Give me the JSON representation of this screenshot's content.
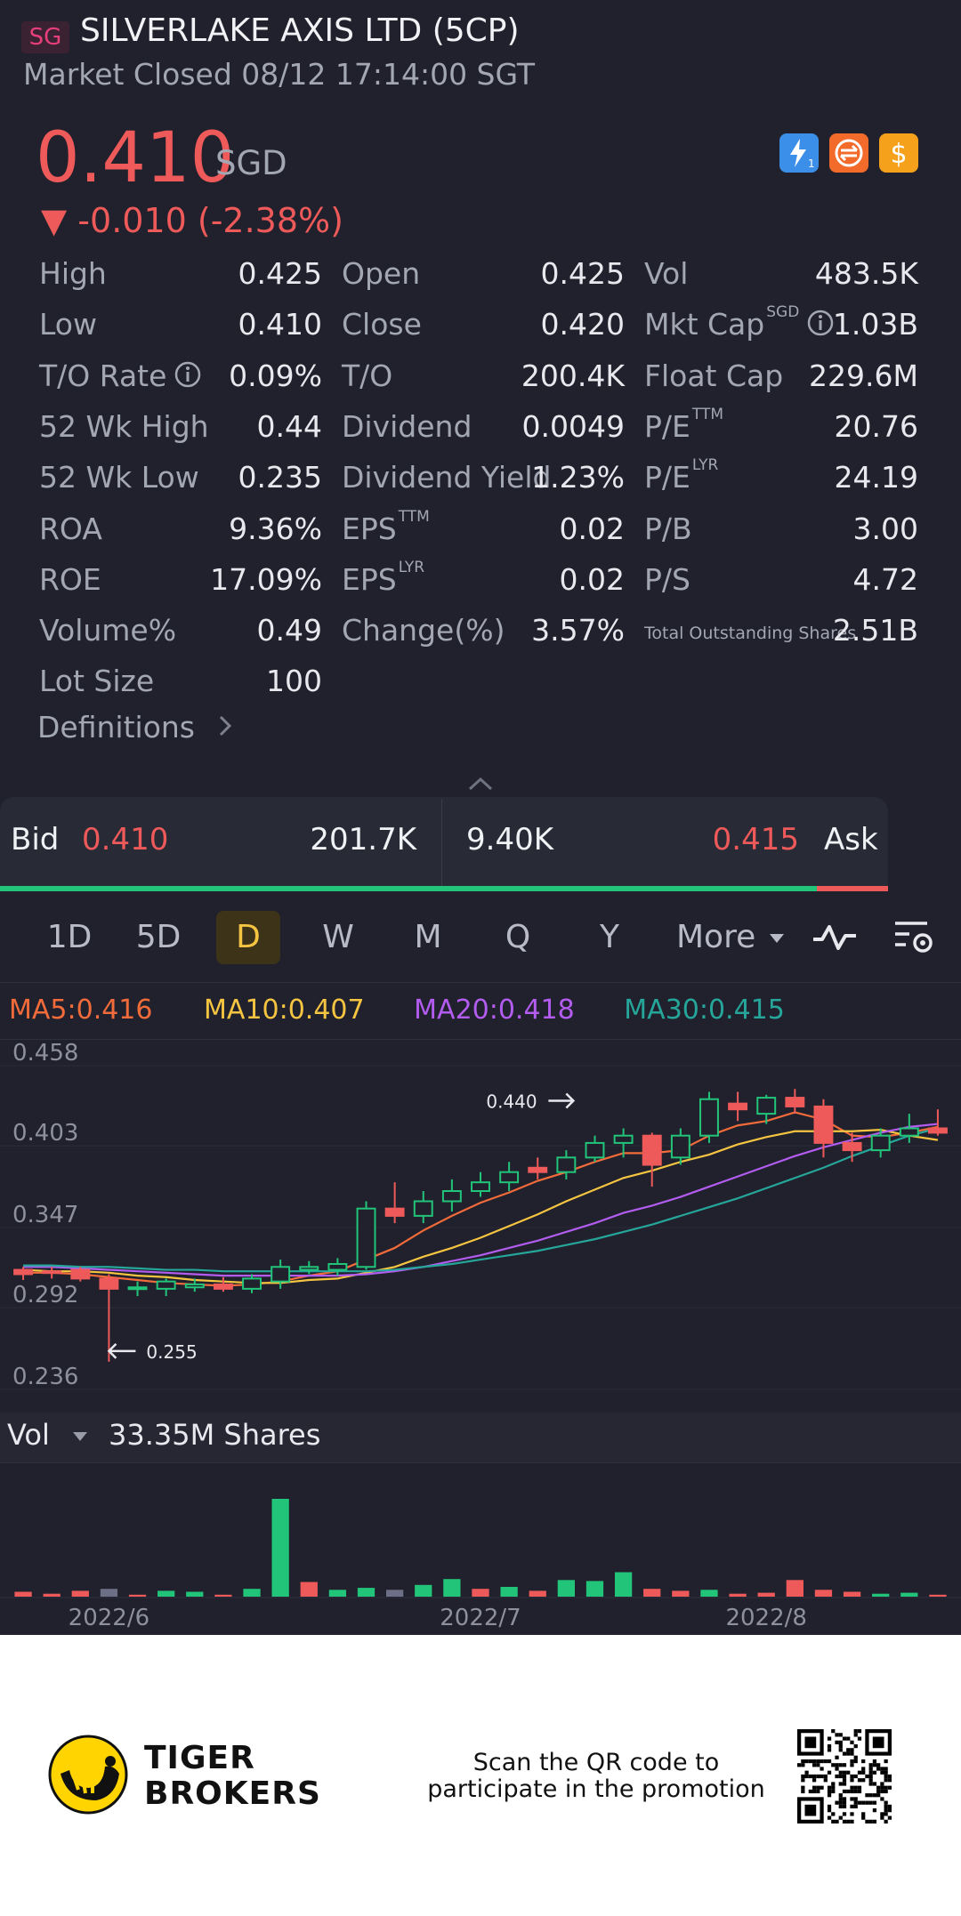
{
  "header": {
    "market_badge": "SG",
    "title": "SILVERLAKE AXIS LTD (5CP)",
    "status": "Market Closed 08/12 17:14:00 SGT"
  },
  "quote": {
    "price": "0.410",
    "currency": "SGD",
    "change": "▼ -0.010 (-2.38%)",
    "badges": [
      {
        "icon": "lightning-level1-icon",
        "color": "#3b8fe8"
      },
      {
        "icon": "swap-arrows-icon",
        "color": "#f26b2a"
      },
      {
        "icon": "dollar-icon",
        "color": "#f5a11c"
      }
    ]
  },
  "stats": {
    "rows": [
      [
        {
          "label": "High",
          "value": "0.425"
        },
        {
          "label": "Open",
          "value": "0.425"
        },
        {
          "label": "Vol",
          "value": "483.5K"
        }
      ],
      [
        {
          "label": "Low",
          "value": "0.410"
        },
        {
          "label": "Close",
          "value": "0.420"
        },
        {
          "label": "Mkt Cap",
          "sup": "SGD",
          "info": true,
          "value": "1.03B"
        }
      ],
      [
        {
          "label": "T/O Rate",
          "info": true,
          "value": "0.09%"
        },
        {
          "label": "T/O",
          "value": "200.4K"
        },
        {
          "label": "Float Cap",
          "value": "229.6M"
        }
      ],
      [
        {
          "label": "52 Wk High",
          "value": "0.44"
        },
        {
          "label": "Dividend",
          "value": "0.0049"
        },
        {
          "label": "P/E",
          "sup": "TTM",
          "value": "20.76"
        }
      ],
      [
        {
          "label": "52 Wk Low",
          "value": "0.235"
        },
        {
          "label": "Dividend Yield",
          "value": "1.23%"
        },
        {
          "label": "P/E",
          "sup": "LYR",
          "value": "24.19"
        }
      ],
      [
        {
          "label": "ROA",
          "value": "9.36%"
        },
        {
          "label": "EPS",
          "sup": "TTM",
          "value": "0.02"
        },
        {
          "label": "P/B",
          "value": "3.00"
        }
      ],
      [
        {
          "label": "ROE",
          "value": "17.09%"
        },
        {
          "label": "EPS",
          "sup": "LYR",
          "value": "0.02"
        },
        {
          "label": "P/S",
          "value": "4.72"
        }
      ],
      [
        {
          "label": "Volume%",
          "value": "0.49"
        },
        {
          "label": "Change(%)",
          "value": "3.57%"
        },
        {
          "label": "Total Outstanding Shares",
          "small": true,
          "value": "2.51B"
        }
      ],
      [
        {
          "label": "Lot Size",
          "value": "100"
        }
      ]
    ],
    "definitions": "Definitions"
  },
  "orderbook": {
    "bid_label": "Bid",
    "bid_price": "0.410",
    "bid_size": "201.7K",
    "ask_size": "9.40K",
    "ask_price": "0.415",
    "ask_label": "Ask",
    "bid_share": 0.92
  },
  "period_tabs": {
    "items": [
      "1D",
      "5D",
      "D",
      "W",
      "M",
      "Q",
      "Y"
    ],
    "active": "D",
    "more": "More"
  },
  "ma_legend": [
    {
      "label": "MA5:0.416",
      "color": "#f26b3a"
    },
    {
      "label": "MA10:0.407",
      "color": "#f5c542"
    },
    {
      "label": "MA20:0.418",
      "color": "#b35cf0"
    },
    {
      "label": "MA30:0.415",
      "color": "#26a69a"
    }
  ],
  "volume_header": {
    "label": "Vol",
    "value": "33.35M Shares"
  },
  "footer": {
    "brand_line1": "TIGER",
    "brand_line2": "BROKERS",
    "promo_line1": "Scan the QR code to",
    "promo_line2": "participate in the promotion"
  },
  "chart_data": {
    "type": "candlestick",
    "y_ticks": [
      "0.458",
      "0.403",
      "0.347",
      "0.292",
      "0.236"
    ],
    "ylim": [
      0.236,
      0.458
    ],
    "x_ticks": [
      {
        "label": "2022/6",
        "index": 3.5
      },
      {
        "label": "2022/7",
        "index": 16.5
      },
      {
        "label": "2022/8",
        "index": 26.5
      }
    ],
    "annotations": [
      {
        "text": "0.440",
        "index": 19,
        "value": 0.44,
        "direction": "right"
      },
      {
        "text": "0.255",
        "index": 3,
        "value": 0.255,
        "direction": "left"
      }
    ],
    "candles": [
      {
        "o": 0.318,
        "h": 0.32,
        "l": 0.311,
        "c": 0.315
      },
      {
        "o": 0.317,
        "h": 0.32,
        "l": 0.312,
        "c": 0.316
      },
      {
        "o": 0.318,
        "h": 0.32,
        "l": 0.31,
        "c": 0.312
      },
      {
        "o": 0.312,
        "h": 0.315,
        "l": 0.255,
        "c": 0.305
      },
      {
        "o": 0.305,
        "h": 0.31,
        "l": 0.3,
        "c": 0.306
      },
      {
        "o": 0.305,
        "h": 0.312,
        "l": 0.3,
        "c": 0.31
      },
      {
        "o": 0.306,
        "h": 0.312,
        "l": 0.303,
        "c": 0.308
      },
      {
        "o": 0.308,
        "h": 0.313,
        "l": 0.303,
        "c": 0.305
      },
      {
        "o": 0.305,
        "h": 0.315,
        "l": 0.302,
        "c": 0.312
      },
      {
        "o": 0.31,
        "h": 0.325,
        "l": 0.305,
        "c": 0.32
      },
      {
        "o": 0.318,
        "h": 0.324,
        "l": 0.315,
        "c": 0.32
      },
      {
        "o": 0.318,
        "h": 0.326,
        "l": 0.314,
        "c": 0.322
      },
      {
        "o": 0.32,
        "h": 0.365,
        "l": 0.318,
        "c": 0.36
      },
      {
        "o": 0.36,
        "h": 0.378,
        "l": 0.35,
        "c": 0.355
      },
      {
        "o": 0.355,
        "h": 0.372,
        "l": 0.35,
        "c": 0.365
      },
      {
        "o": 0.365,
        "h": 0.38,
        "l": 0.358,
        "c": 0.372
      },
      {
        "o": 0.372,
        "h": 0.385,
        "l": 0.368,
        "c": 0.378
      },
      {
        "o": 0.378,
        "h": 0.392,
        "l": 0.372,
        "c": 0.385
      },
      {
        "o": 0.388,
        "h": 0.395,
        "l": 0.38,
        "c": 0.385
      },
      {
        "o": 0.385,
        "h": 0.4,
        "l": 0.38,
        "c": 0.395
      },
      {
        "o": 0.395,
        "h": 0.41,
        "l": 0.392,
        "c": 0.405
      },
      {
        "o": 0.405,
        "h": 0.415,
        "l": 0.395,
        "c": 0.41
      },
      {
        "o": 0.41,
        "h": 0.412,
        "l": 0.375,
        "c": 0.39
      },
      {
        "o": 0.395,
        "h": 0.415,
        "l": 0.39,
        "c": 0.41
      },
      {
        "o": 0.41,
        "h": 0.44,
        "l": 0.405,
        "c": 0.435
      },
      {
        "o": 0.432,
        "h": 0.44,
        "l": 0.42,
        "c": 0.428
      },
      {
        "o": 0.425,
        "h": 0.438,
        "l": 0.418,
        "c": 0.436
      },
      {
        "o": 0.436,
        "h": 0.442,
        "l": 0.425,
        "c": 0.43
      },
      {
        "o": 0.43,
        "h": 0.435,
        "l": 0.395,
        "c": 0.405
      },
      {
        "o": 0.405,
        "h": 0.412,
        "l": 0.392,
        "c": 0.4
      },
      {
        "o": 0.4,
        "h": 0.415,
        "l": 0.395,
        "c": 0.41
      },
      {
        "o": 0.41,
        "h": 0.425,
        "l": 0.405,
        "c": 0.415
      },
      {
        "o": 0.415,
        "h": 0.428,
        "l": 0.41,
        "c": 0.412
      }
    ],
    "ma": [
      {
        "name": "MA5",
        "color": "#f26b3a",
        "values": [
          0.316,
          0.316,
          0.315,
          0.313,
          0.311,
          0.309,
          0.308,
          0.307,
          0.308,
          0.31,
          0.314,
          0.317,
          0.325,
          0.333,
          0.345,
          0.355,
          0.364,
          0.371,
          0.379,
          0.385,
          0.392,
          0.398,
          0.398,
          0.4,
          0.41,
          0.417,
          0.42,
          0.426,
          0.421,
          0.41,
          0.409,
          0.412,
          0.416
        ]
      },
      {
        "name": "MA10",
        "color": "#f5c542",
        "values": [
          0.318,
          0.317,
          0.317,
          0.316,
          0.314,
          0.313,
          0.311,
          0.31,
          0.309,
          0.309,
          0.311,
          0.312,
          0.316,
          0.32,
          0.327,
          0.333,
          0.34,
          0.348,
          0.356,
          0.365,
          0.373,
          0.381,
          0.386,
          0.392,
          0.397,
          0.404,
          0.409,
          0.413,
          0.413,
          0.413,
          0.414,
          0.41,
          0.407
        ]
      },
      {
        "name": "MA20",
        "color": "#b35cf0",
        "values": [
          0.32,
          0.32,
          0.319,
          0.318,
          0.317,
          0.316,
          0.315,
          0.314,
          0.314,
          0.314,
          0.314,
          0.314,
          0.315,
          0.317,
          0.32,
          0.324,
          0.328,
          0.333,
          0.338,
          0.344,
          0.35,
          0.357,
          0.362,
          0.368,
          0.375,
          0.382,
          0.389,
          0.396,
          0.402,
          0.407,
          0.412,
          0.416,
          0.418
        ]
      },
      {
        "name": "MA30",
        "color": "#26a69a",
        "values": [
          0.321,
          0.321,
          0.32,
          0.32,
          0.319,
          0.318,
          0.318,
          0.317,
          0.317,
          0.317,
          0.317,
          0.317,
          0.317,
          0.318,
          0.32,
          0.322,
          0.325,
          0.328,
          0.331,
          0.335,
          0.339,
          0.344,
          0.349,
          0.355,
          0.361,
          0.367,
          0.374,
          0.381,
          0.388,
          0.396,
          0.403,
          0.41,
          0.415
        ]
      }
    ],
    "volume": [
      {
        "v": 0.05,
        "dir": "down"
      },
      {
        "v": 0.03,
        "dir": "down"
      },
      {
        "v": 0.06,
        "dir": "down"
      },
      {
        "v": 0.08,
        "dir": "flat"
      },
      {
        "v": 0.02,
        "dir": "down"
      },
      {
        "v": 0.06,
        "dir": "up"
      },
      {
        "v": 0.05,
        "dir": "up"
      },
      {
        "v": 0.02,
        "dir": "down"
      },
      {
        "v": 0.08,
        "dir": "up"
      },
      {
        "v": 1.0,
        "dir": "up"
      },
      {
        "v": 0.15,
        "dir": "down"
      },
      {
        "v": 0.07,
        "dir": "up"
      },
      {
        "v": 0.09,
        "dir": "up"
      },
      {
        "v": 0.07,
        "dir": "flat"
      },
      {
        "v": 0.12,
        "dir": "up"
      },
      {
        "v": 0.18,
        "dir": "up"
      },
      {
        "v": 0.08,
        "dir": "down"
      },
      {
        "v": 0.1,
        "dir": "up"
      },
      {
        "v": 0.06,
        "dir": "down"
      },
      {
        "v": 0.17,
        "dir": "up"
      },
      {
        "v": 0.16,
        "dir": "up"
      },
      {
        "v": 0.25,
        "dir": "up"
      },
      {
        "v": 0.08,
        "dir": "down"
      },
      {
        "v": 0.06,
        "dir": "down"
      },
      {
        "v": 0.07,
        "dir": "up"
      },
      {
        "v": 0.03,
        "dir": "down"
      },
      {
        "v": 0.04,
        "dir": "down"
      },
      {
        "v": 0.17,
        "dir": "down"
      },
      {
        "v": 0.07,
        "dir": "down"
      },
      {
        "v": 0.05,
        "dir": "down"
      },
      {
        "v": 0.03,
        "dir": "up"
      },
      {
        "v": 0.04,
        "dir": "up"
      },
      {
        "v": 0.02,
        "dir": "down"
      }
    ]
  }
}
